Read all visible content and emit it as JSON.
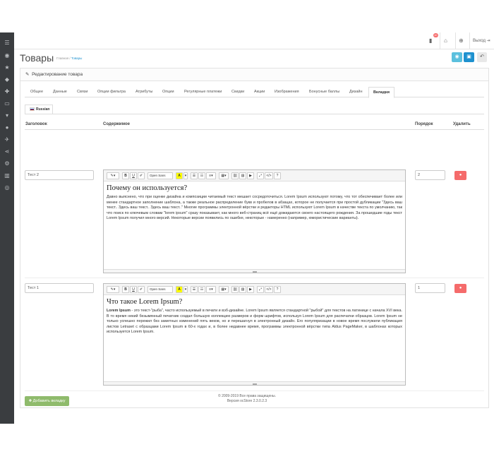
{
  "topbar": {
    "notif_count": "10",
    "logout_label": "Выход"
  },
  "page": {
    "title": "Товары",
    "breadcrumb": [
      "Главная",
      "Товары"
    ],
    "panel_title": "Редактирование товара"
  },
  "tabs": [
    "Общее",
    "Данные",
    "Связи",
    "Опции фильтра",
    "Атрибуты",
    "Опции",
    "Регулярные платежи",
    "Скидки",
    "Акции",
    "Изображения",
    "Бонусные баллы",
    "Дизайн",
    "Вкладки"
  ],
  "active_tab": "Вкладки",
  "language_tab": "Russian",
  "table": {
    "headers": {
      "title": "Заголовок",
      "content": "Содержимое",
      "order": "Порядок",
      "delete": "Удалить"
    },
    "rows": [
      {
        "title": "Тест 2",
        "order": "2",
        "heading": "Почему он используется?",
        "text": "Давно выяснено, что при оценке дизайна и композиции читаемый текст мешает сосредоточиться. Lorem Ipsum используют потому, что тот обеспечивает более или менее стандартное заполнение шаблона, а также реальное распределение букв и пробелов в абзацах, которое не получается при простой дубликации \"Здесь ваш текст.. Здесь ваш текст.. Здесь ваш текст..\" Многие программы электронной вёрстки и редакторы HTML используют Lorem Ipsum в качестве текста по умолчанию, так что поиск по ключевым словам \"lorem ipsum\" сразу показывает, как много веб-страниц всё ещё дожидаются своего настоящего рождения. За прошедшие годы текст Lorem Ipsum получил много версий. Некоторые версии появились по ошибке, некоторые - намеренно (например, юмористические варианты)."
      },
      {
        "title": "Тест 1",
        "order": "1",
        "heading": "Что такое Lorem Ipsum?",
        "bold_lead": "Lorem Ipsum",
        "text": " - это текст-\"рыба\", часто используемый в печати и вэб-дизайне. Lorem Ipsum является стандартной \"рыбой\" для текстов на латинице с начала XVI века. В то время некий безымянный печатник создал большую коллекцию размеров и форм шрифтов, используя Lorem Ipsum для распечатки образцов. Lorem Ipsum не только успешно пережил без заметных изменений пять веков, но и перешагнул в электронный дизайн. Его популяризации в новое время послужили публикация листов Letraset с образцами Lorem Ipsum в 60-х годах и, в более недавнее время, программы электронной вёрстки типа Aldus PageMaker, в шаблонах которых используется Lorem Ipsum."
      }
    ]
  },
  "editor": {
    "font_select": "Open Sans"
  },
  "add_button": "Добавить вкладку",
  "footer": {
    "copyright": "© 2009-2019 Все права защищены.",
    "version": "Версия ocStore 2.3.0.2.3"
  },
  "colors": {
    "sidebar": "#3a3d40",
    "info": "#5bc0de",
    "primary": "#1e91cf",
    "danger": "#f56b6b",
    "success": "#8fbb6c"
  }
}
